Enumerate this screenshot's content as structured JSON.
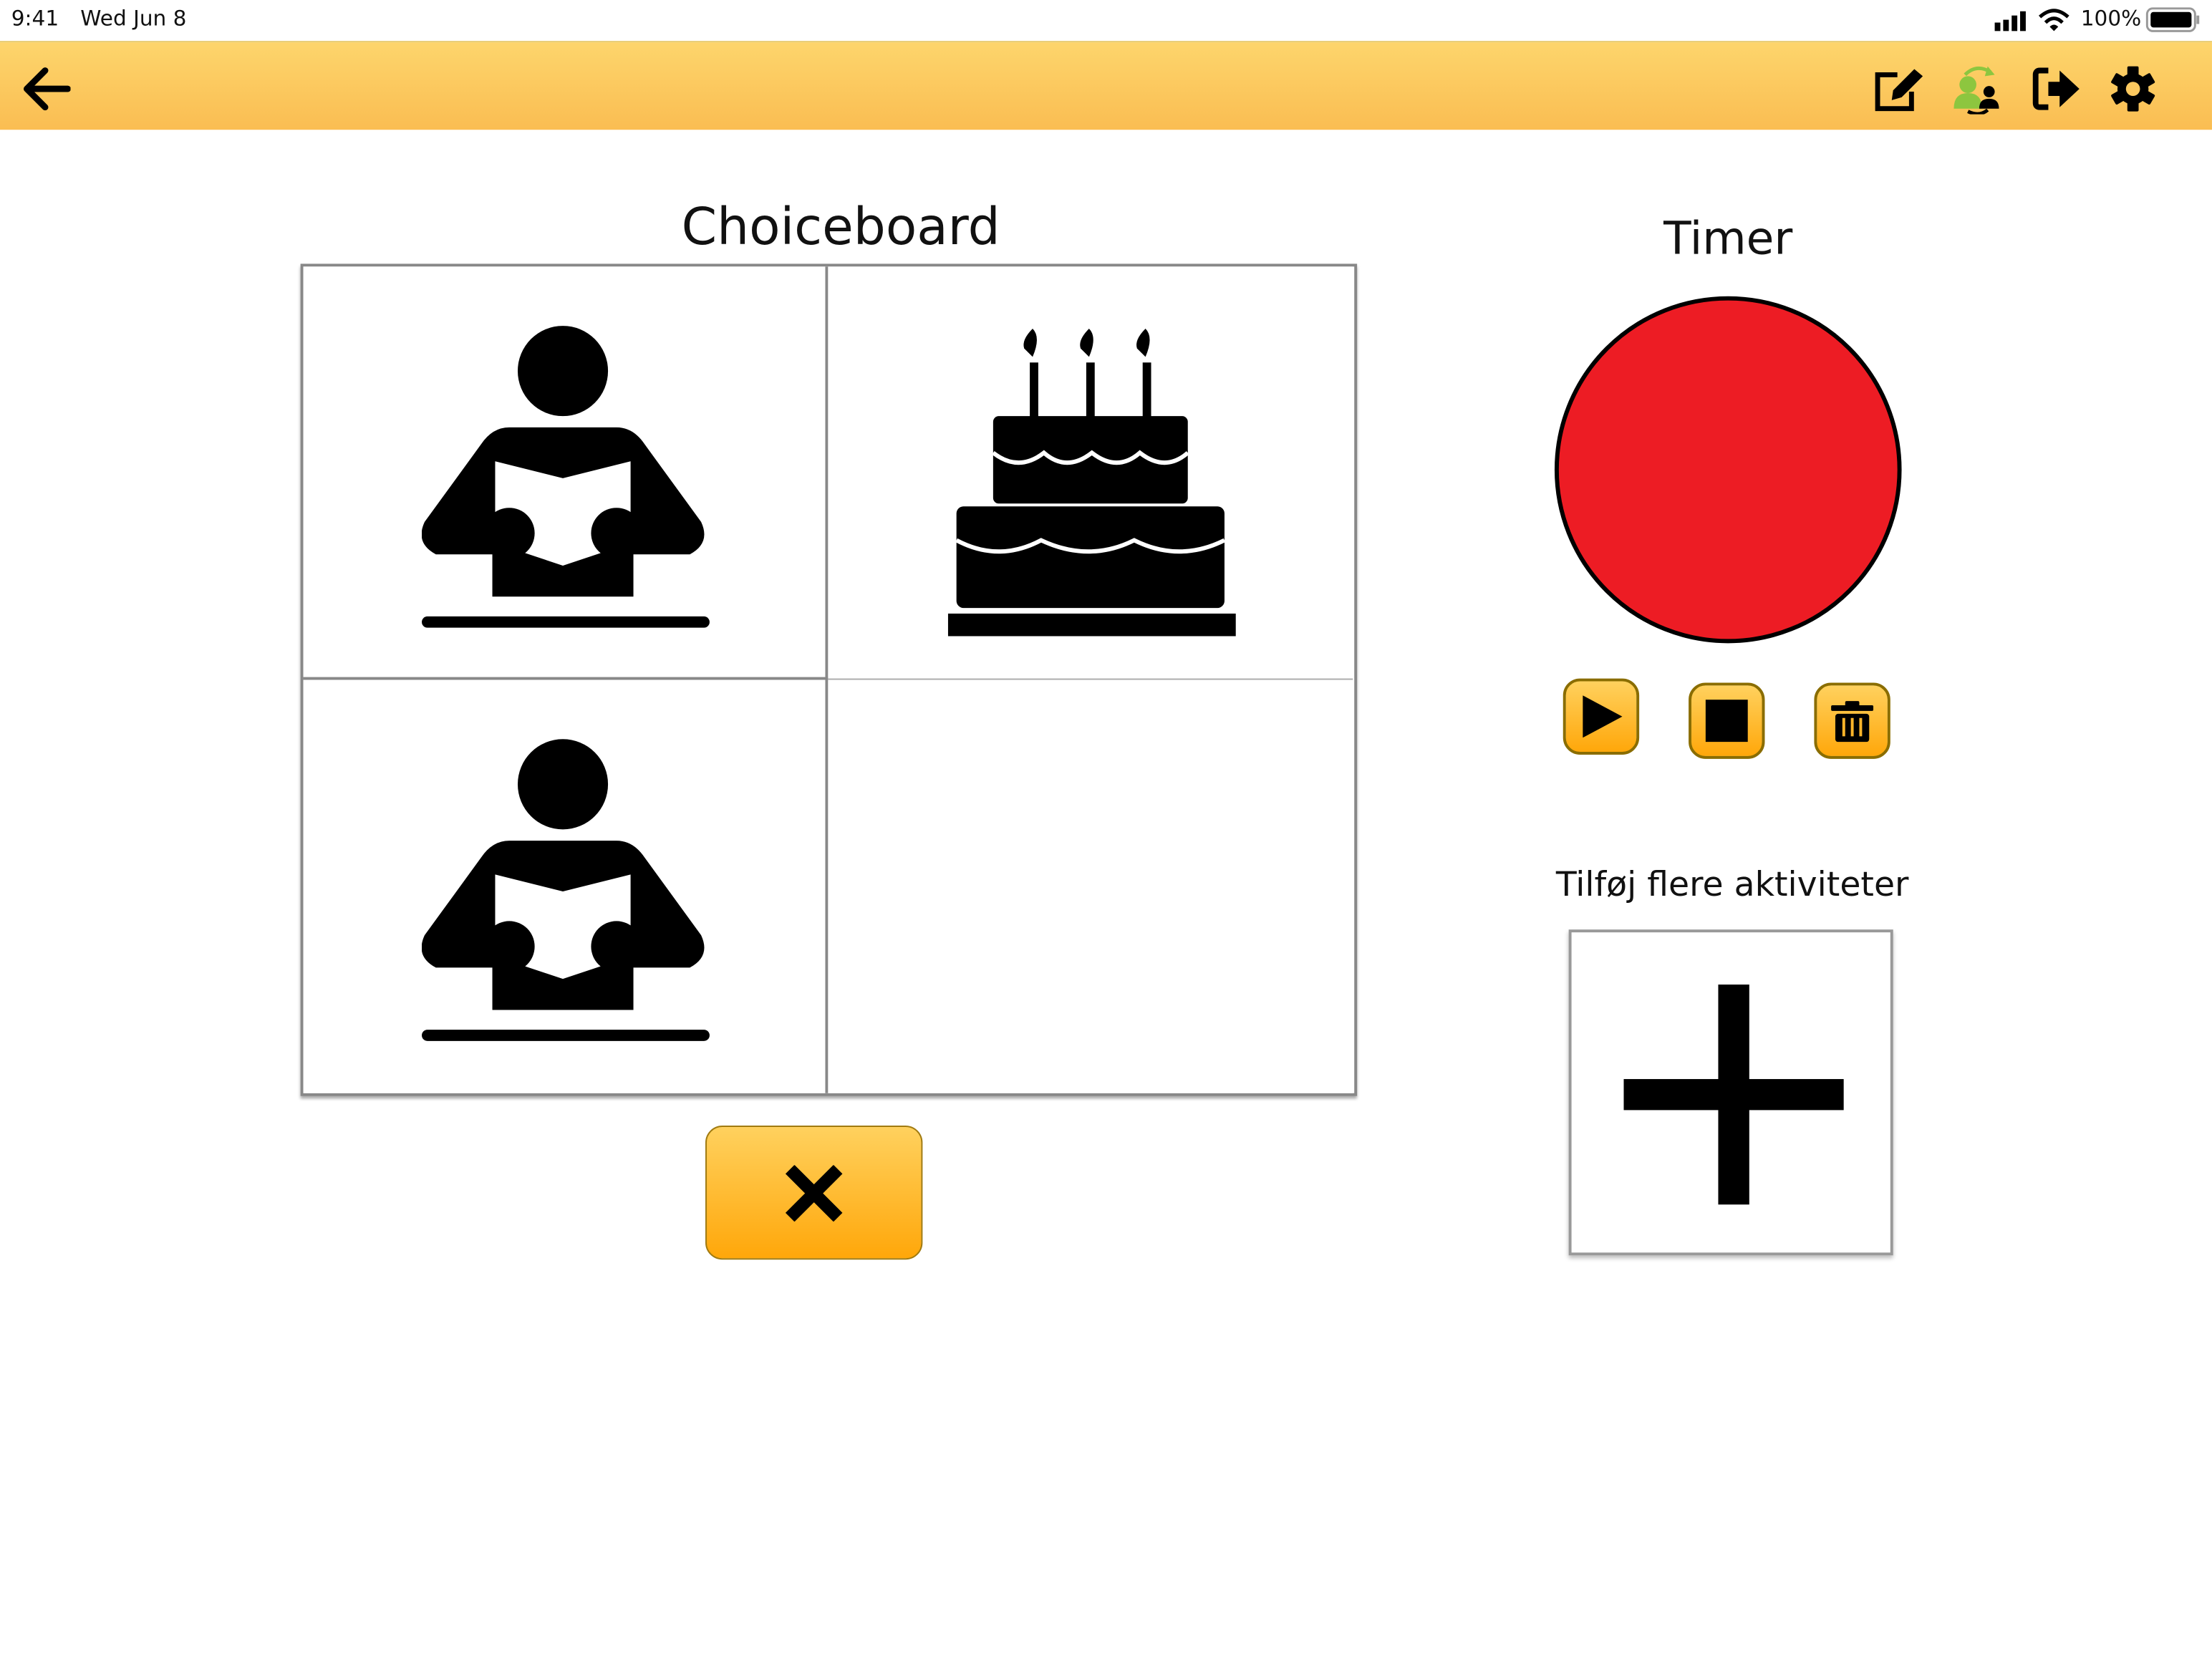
{
  "status_bar": {
    "time": "9:41",
    "date": "Wed Jun 8",
    "battery": "100%"
  },
  "header": {
    "back_icon": "arrow-left-icon",
    "actions": [
      "edit-icon",
      "switch-user-icon",
      "logout-icon",
      "gear-icon"
    ],
    "background": "#fcc95f"
  },
  "choiceboard": {
    "title": "Choiceboard",
    "cells": [
      {
        "pictogram": "reading-person"
      },
      {
        "pictogram": "birthday-cake"
      },
      {
        "pictogram": "reading-person"
      },
      {
        "pictogram": "empty"
      }
    ],
    "close_icon": "close-x-icon"
  },
  "timer": {
    "title": "Timer",
    "color": "#ed1c24",
    "controls": [
      "play-icon",
      "stop-icon",
      "trash-icon"
    ]
  },
  "add_activities": {
    "label": "Tilføj flere aktiviteter",
    "icon": "plus-icon"
  }
}
